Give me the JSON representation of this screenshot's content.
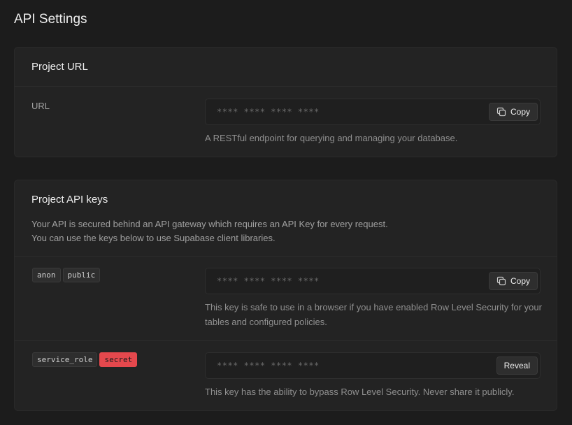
{
  "page": {
    "title": "API Settings"
  },
  "project_url": {
    "title": "Project URL",
    "row_label": "URL",
    "masked_value": "**** **** **** ****",
    "copy_label": "Copy",
    "copy_icon": "copy-icon",
    "helper": "A RESTful endpoint for querying and managing your database."
  },
  "api_keys": {
    "title": "Project API keys",
    "description_line1": "Your API is secured behind an API gateway which requires an API Key for every request.",
    "description_line2": "You can use the keys below to use Supabase client libraries.",
    "anon": {
      "tags": [
        "anon",
        "public"
      ],
      "masked_value": "**** **** **** ****",
      "copy_label": "Copy",
      "helper": "This key is safe to use in a browser if you have enabled Row Level Security for your tables and configured policies."
    },
    "service": {
      "tags": [
        "service_role",
        "secret"
      ],
      "masked_value": "**** **** **** ****",
      "reveal_label": "Reveal",
      "helper": "This key has the ability to bypass Row Level Security. Never share it publicly."
    }
  },
  "colors": {
    "background": "#1c1c1c",
    "panel": "#232323",
    "secret_badge": "#e5484d"
  }
}
